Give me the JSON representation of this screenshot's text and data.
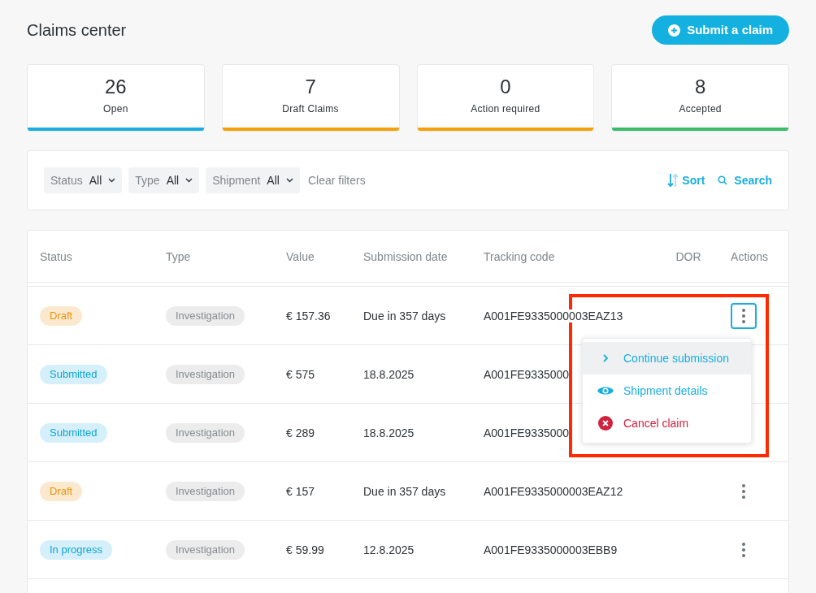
{
  "title": "Claims center",
  "submit_button": "Submit a claim",
  "stats": [
    {
      "count": "26",
      "label": "Open",
      "color": "#1aaee0"
    },
    {
      "count": "7",
      "label": "Draft Claims",
      "color": "#f5a00a"
    },
    {
      "count": "0",
      "label": "Action required",
      "color": "#f5a00a"
    },
    {
      "count": "8",
      "label": "Accepted",
      "color": "#3dba6a"
    }
  ],
  "filters": [
    {
      "label": "Status",
      "value": "All"
    },
    {
      "label": "Type",
      "value": "All"
    },
    {
      "label": "Shipment",
      "value": "All"
    }
  ],
  "clear_filters": "Clear filters",
  "sort": "Sort",
  "search": "Search",
  "table": {
    "columns": [
      "Status",
      "Type",
      "Value",
      "Submission date",
      "Tracking code",
      "DOR",
      "Actions"
    ],
    "rows": [
      {
        "status": "Draft",
        "kind": "draft",
        "type": "Investigation",
        "value": "€ 157.36",
        "date": "Due in 357 days",
        "tracking": "A001FE9335000003EAZ13",
        "actions_shown": true,
        "menu_open": true
      },
      {
        "status": "Submitted",
        "kind": "submitted",
        "type": "Investigation",
        "value": "€ 575",
        "date": "18.8.2025",
        "tracking": "A001FE9335000",
        "actions_shown": false,
        "menu_open": false
      },
      {
        "status": "Submitted",
        "kind": "submitted",
        "type": "Investigation",
        "value": "€ 289",
        "date": "18.8.2025",
        "tracking": "A001FE9335000",
        "actions_shown": false,
        "menu_open": false
      },
      {
        "status": "Draft",
        "kind": "draft",
        "type": "Investigation",
        "value": "€ 157",
        "date": "Due in 357 days",
        "tracking": "A001FE9335000003EAZ12",
        "actions_shown": true,
        "menu_open": false
      },
      {
        "status": "In progress",
        "kind": "submitted",
        "type": "Investigation",
        "value": "€ 59.99",
        "date": "12.8.2025",
        "tracking": "A001FE9335000003EBB9",
        "actions_shown": true,
        "menu_open": false
      }
    ]
  },
  "menu": [
    {
      "label": "Continue submission",
      "kind": "continue",
      "selected": true
    },
    {
      "label": "Shipment details",
      "kind": "view",
      "selected": false
    },
    {
      "label": "Cancel claim",
      "kind": "cancel",
      "selected": false
    }
  ]
}
